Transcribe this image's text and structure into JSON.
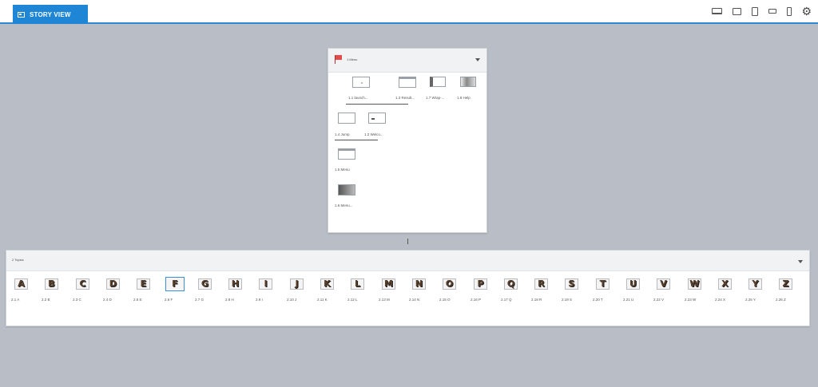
{
  "header": {
    "tab_label": "STORY VIEW",
    "device_icons": [
      "laptop-icon",
      "desktop-icon",
      "tablet-portrait-icon",
      "tablet-landscape-icon",
      "phone-icon"
    ],
    "settings_icon": "gear-icon"
  },
  "menu_scene": {
    "title": "1 Menu",
    "slides": [
      {
        "label": "1.1 launch..."
      },
      {
        "label": "1.3 Result..."
      },
      {
        "label": "1.7 Wrap-..."
      },
      {
        "label": "1.8 Help"
      },
      {
        "label": "1.4 Jump"
      },
      {
        "label": "1.2 Welco..."
      },
      {
        "label": "1.5 Menu"
      },
      {
        "label": "1.6 Menu..."
      }
    ]
  },
  "topics_scene": {
    "title": "2 Topics",
    "selected_index": 5,
    "slides": [
      {
        "letter": "A",
        "label": "2.1 A"
      },
      {
        "letter": "B",
        "label": "2.2 B"
      },
      {
        "letter": "C",
        "label": "2.3 C"
      },
      {
        "letter": "D",
        "label": "2.4 D"
      },
      {
        "letter": "E",
        "label": "2.5 E"
      },
      {
        "letter": "F",
        "label": "2.6 F"
      },
      {
        "letter": "G",
        "label": "2.7 G"
      },
      {
        "letter": "H",
        "label": "2.8 H"
      },
      {
        "letter": "I",
        "label": "2.9 I"
      },
      {
        "letter": "J",
        "label": "2.10 J"
      },
      {
        "letter": "K",
        "label": "2.11 K"
      },
      {
        "letter": "L",
        "label": "2.12 L"
      },
      {
        "letter": "M",
        "label": "2.13 M"
      },
      {
        "letter": "N",
        "label": "2.14 N"
      },
      {
        "letter": "O",
        "label": "2.15 O"
      },
      {
        "letter": "P",
        "label": "2.16 P"
      },
      {
        "letter": "Q",
        "label": "2.17 Q"
      },
      {
        "letter": "R",
        "label": "2.18 R"
      },
      {
        "letter": "S",
        "label": "2.19 S"
      },
      {
        "letter": "T",
        "label": "2.20 T"
      },
      {
        "letter": "U",
        "label": "2.21 U"
      },
      {
        "letter": "V",
        "label": "2.22 V"
      },
      {
        "letter": "W",
        "label": "2.23 W"
      },
      {
        "letter": "X",
        "label": "2.24 X"
      },
      {
        "letter": "Y",
        "label": "2.25 Y"
      },
      {
        "letter": "Z",
        "label": "2.26 Z"
      }
    ]
  },
  "colors": {
    "accent": "#1f86d6",
    "canvas": "#b9bec6",
    "letter_fill": "#5a3f2a"
  }
}
